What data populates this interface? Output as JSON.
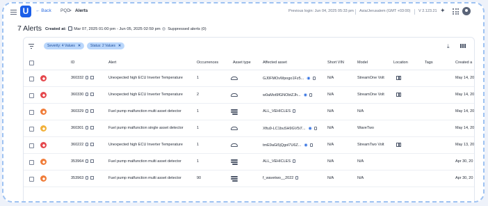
{
  "nav": {
    "back_label": "← Back",
    "breadcrumb": [
      "PQD",
      "Alerts"
    ],
    "breadcrumb_sep": ">",
    "previous_login": "Previous login: Jun 04, 2025 05:33 pm",
    "timezone": "Asia/Jerusalem (GMT +03:00)",
    "version": "V 2.123.21"
  },
  "header": {
    "title": "7 Alerts",
    "created_label": "Created at:",
    "created_range": "Mar 07, 2025 01:00 pm - Jun 05, 2025 02:59 pm",
    "suppressed": "Suppressed alerts (0)"
  },
  "filters": [
    {
      "label": "Severity: 4 Values"
    },
    {
      "label": "Status: 2 Values"
    }
  ],
  "columns": [
    "ID",
    "Alert",
    "Occurrences",
    "Asset type",
    "Affected asset",
    "Short VIN",
    "Model",
    "Location",
    "Tags",
    "Created a"
  ],
  "colors": {
    "critical": "#e5484d",
    "high": "#f07d3a",
    "medium": "#f2b13a",
    "accent": "#2a6be0"
  },
  "rows": [
    {
      "id": "360332",
      "severity": "critical",
      "alert": "Unexpected high ECU Inverter Temperature",
      "occurrences": "1",
      "asset_type": "car-icon",
      "affected": "GJ0FMOvWpogo1Fz5...",
      "affected_has_eye": true,
      "short_vin": "N/A",
      "model": "StreamOne Volt",
      "has_location": true,
      "created": "May 14, 20"
    },
    {
      "id": "360330",
      "severity": "critical",
      "alert": "Unexpected high ECU Inverter Temperature",
      "occurrences": "2",
      "asset_type": "car-icon",
      "affected": "w0aMot9fGNObtZJh...",
      "affected_has_eye": true,
      "short_vin": "N/A",
      "model": "StreamOne Volt",
      "has_location": true,
      "created": "May 14, 20"
    },
    {
      "id": "360329",
      "severity": "high",
      "alert": "Fuel pump malfunction multi asset detector",
      "occurrences": "1",
      "asset_type": "multi-asset-icon",
      "affected": "ALL_VEHICLES",
      "affected_has_eye": false,
      "short_vin": "N/A",
      "model": "N/A",
      "has_location": false,
      "created": "May 14, 20"
    },
    {
      "id": "360301",
      "severity": "medium",
      "alert": "Fuel pump malfunction single asset detector",
      "occurrences": "1",
      "asset_type": "car-icon",
      "affected": "Xftu9-LC1buSH9GV5i7...",
      "affected_has_eye": true,
      "short_vin": "N/A",
      "model": "WaveTwo",
      "has_location": false,
      "created": "May 14, 20"
    },
    {
      "id": "360222",
      "severity": "critical",
      "alert": "Unexpected high ECU Inverter Temperature",
      "occurrences": "1",
      "asset_type": "car-icon",
      "affected": "tmE9aGi5jQgol7U6Z...",
      "affected_has_eye": true,
      "short_vin": "N/A",
      "model": "StreamTwo Volt",
      "has_location": true,
      "created": "May 13, 20"
    },
    {
      "id": "353964",
      "severity": "high",
      "alert": "Fuel pump malfunction multi asset detector",
      "occurrences": "1",
      "asset_type": "multi-asset-icon",
      "affected": "ALL_VEHICLES",
      "affected_has_eye": false,
      "short_vin": "N/A",
      "model": "N/A",
      "has_location": false,
      "created": "Apr 30, 20"
    },
    {
      "id": "353963",
      "severity": "high",
      "alert": "Fuel pump malfunction multi asset detector",
      "occurrences": "90",
      "asset_type": "multi-asset-icon",
      "affected": "f_wavetwo__2022",
      "affected_has_eye": false,
      "short_vin": "N/A",
      "model": "N/A",
      "has_location": false,
      "created": "Apr 30, 20"
    }
  ]
}
